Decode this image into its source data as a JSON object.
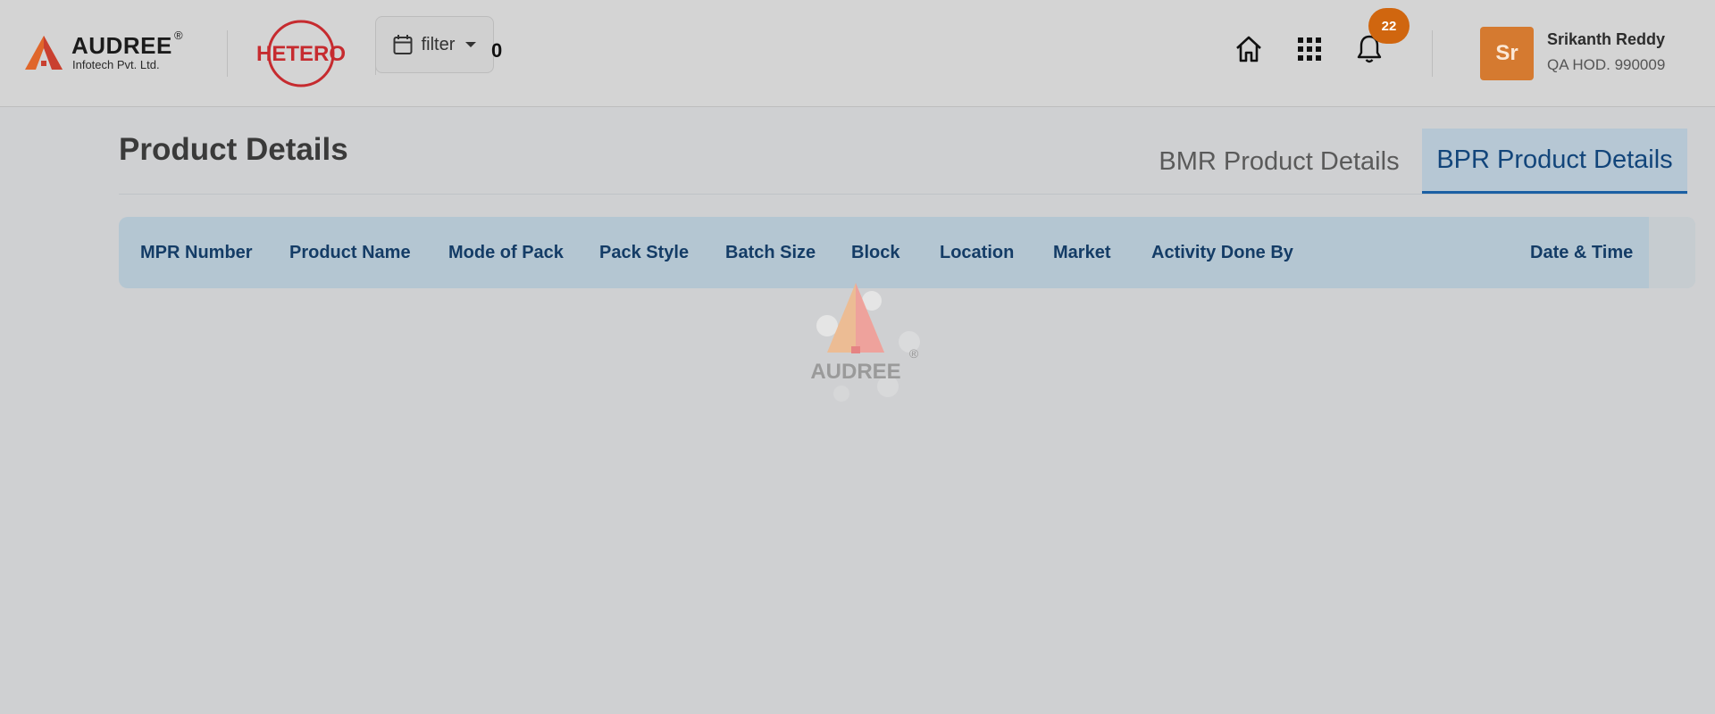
{
  "brand": {
    "name": "AUDREE",
    "reg": "®",
    "subtitle": "Infotech Pvt. Ltd."
  },
  "client_logo_text": "HETERO",
  "header": {
    "filter_label": "filter",
    "filter_icon": "calendar-icon",
    "zero_text": "0",
    "notification_count": "22",
    "icons": [
      "home-icon",
      "apps-grid-icon",
      "bell-icon"
    ]
  },
  "user": {
    "initials": "Sr",
    "name": "Srikanth Reddy",
    "role": "QA HOD. 990009"
  },
  "page": {
    "title": "Product Details",
    "tabs": [
      {
        "label": "BMR Product Details",
        "active": false
      },
      {
        "label": "BPR Product Details",
        "active": true
      }
    ]
  },
  "table": {
    "columns": [
      "MPR Number",
      "Product Name",
      "Mode of Pack",
      "Pack Style",
      "Batch Size",
      "Block",
      "Location",
      "Market",
      "Activity Done By",
      "Date & Time"
    ]
  },
  "loader": {
    "text": "AUDREE",
    "reg": "®"
  },
  "colors": {
    "accent": "#d0660f",
    "tab_active_text": "#12457a",
    "header_cell_text": "#143c66",
    "avatar_bg": "#d57a30"
  }
}
